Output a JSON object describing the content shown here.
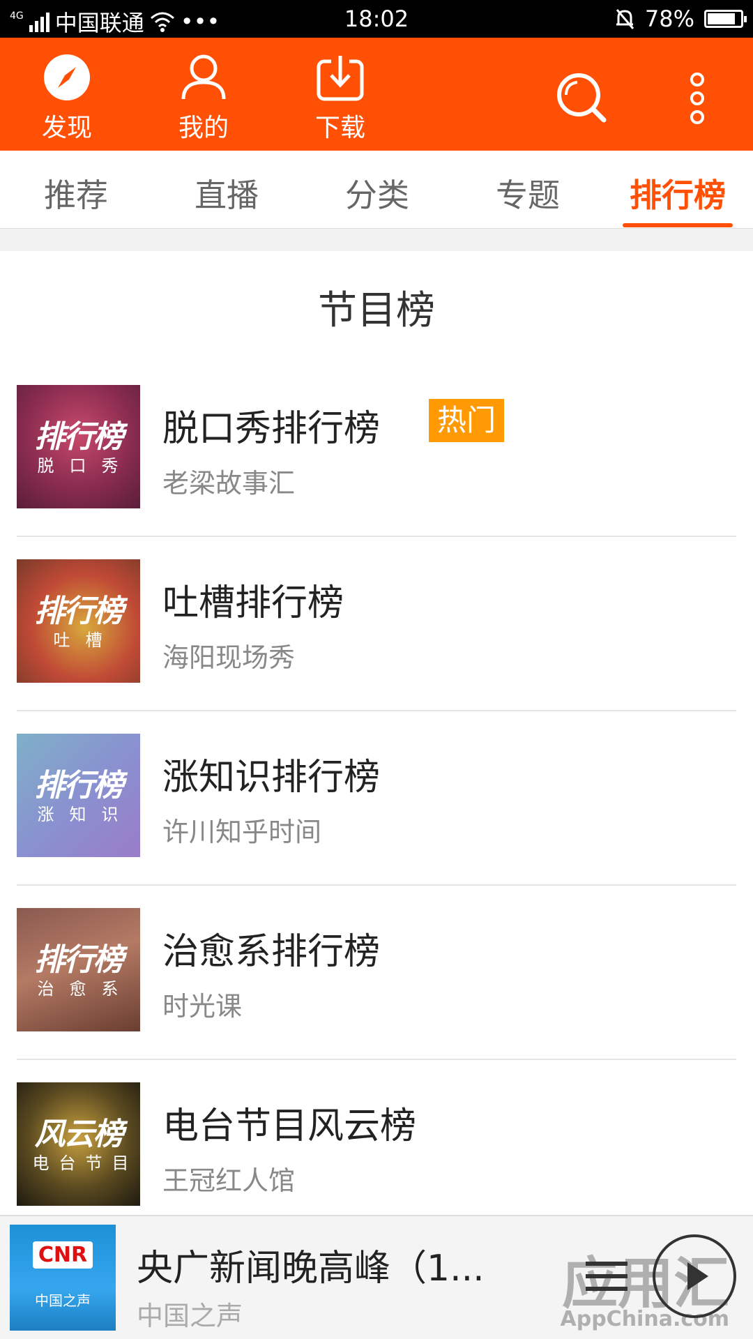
{
  "status": {
    "network": "4G",
    "carrier": "中国联通",
    "dots": "•••",
    "time": "18:02",
    "battery": "78%",
    "battery_fraction": 0.78
  },
  "topbar": {
    "discover": "发现",
    "mine": "我的",
    "download": "下载"
  },
  "tabs": [
    "推荐",
    "直播",
    "分类",
    "专题",
    "排行榜"
  ],
  "section_title": "节目榜",
  "items": [
    {
      "name": "脱口秀排行榜",
      "author": "老梁故事汇",
      "badge": "热门",
      "cover_big": "排行榜",
      "cover_small": "脱口秀"
    },
    {
      "name": "吐槽排行榜",
      "author": "海阳现场秀",
      "cover_big": "排行榜",
      "cover_small": "吐槽"
    },
    {
      "name": "涨知识排行榜",
      "author": "许川知乎时间",
      "cover_big": "排行榜",
      "cover_small": "涨知识"
    },
    {
      "name": "治愈系排行榜",
      "author": "时光课",
      "cover_big": "排行榜",
      "cover_small": "治愈系"
    },
    {
      "name": "电台节目风云榜",
      "author": "王冠红人馆",
      "cover_big": "风云榜",
      "cover_small": "电台节目"
    }
  ],
  "player": {
    "cover_logo": "CNR",
    "cover_sub": "中国之声",
    "title": "央广新闻晚高峰（1...",
    "subtitle": "中国之声"
  },
  "watermark": {
    "text": "应用汇",
    "en": "AppChina.com"
  },
  "colors": {
    "accent": "#ff5005",
    "badge": "#ff9a05"
  }
}
